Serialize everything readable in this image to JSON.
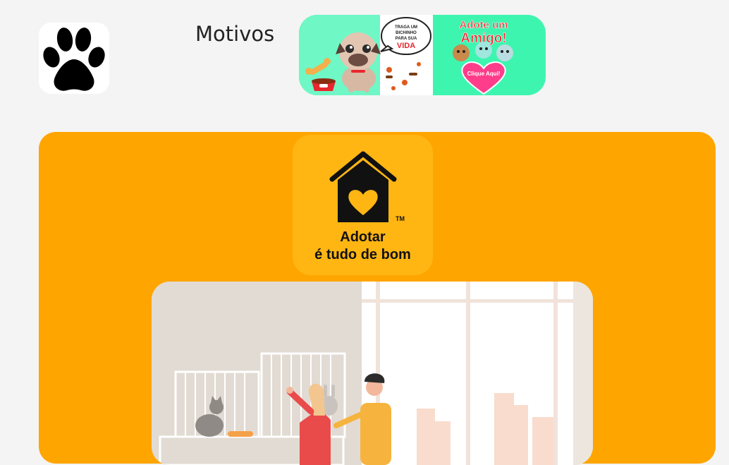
{
  "header": {
    "logo_icon": "paw-icon",
    "nav_link": "Motivos"
  },
  "banner": {
    "speech_line1": "TRAGA UM",
    "speech_line2": "BICHINHO",
    "speech_line3": "PARA SUA",
    "speech_line4": "VIDA",
    "title_line1": "Adote um",
    "title_line2": "Amigo!",
    "cta": "Clique Aqui!"
  },
  "adopt_card": {
    "logo_icon": "house-heart-icon",
    "trademark": "TM",
    "line1": "Adotar",
    "line2": "é tudo de bom"
  },
  "colors": {
    "page_bg": "#f4f4f4",
    "card_bg": "#ffa500",
    "logo_tile": "#ffb613",
    "banner_green": "#3ef5b0",
    "banner_red": "#e8262d"
  }
}
